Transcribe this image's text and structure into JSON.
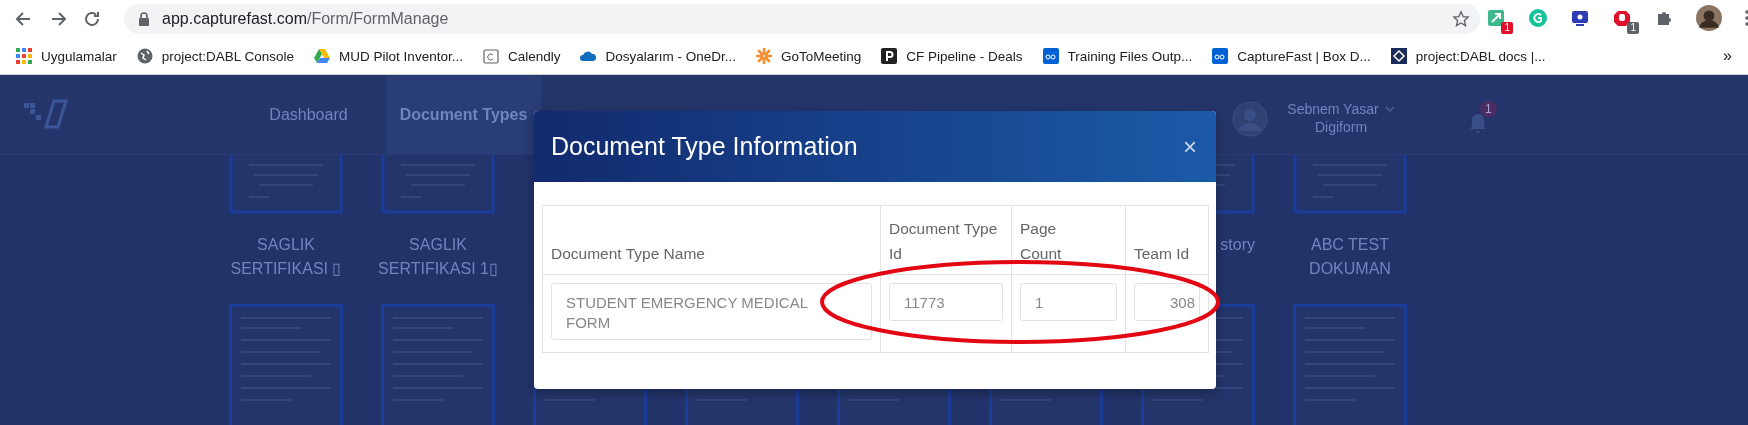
{
  "browser": {
    "url_host": "app.capturefast.com",
    "url_path": "/Form/FormManage",
    "extensions": [
      {
        "kind": "arrow",
        "badge": "1"
      },
      {
        "kind": "grammar"
      },
      {
        "kind": "screen"
      },
      {
        "kind": "hand",
        "badge": "1"
      },
      {
        "kind": "puzzle"
      },
      {
        "kind": "profile"
      }
    ],
    "bookmarks": [
      {
        "kind": "apps",
        "label": "Uygulamalar"
      },
      {
        "kind": "globe",
        "label": "project:DABL Console"
      },
      {
        "kind": "drive",
        "label": "MUD Pilot Inventor..."
      },
      {
        "kind": "calendar",
        "label": "Calendly"
      },
      {
        "kind": "cloud",
        "label": "Dosyalarım - OneDr..."
      },
      {
        "kind": "flower",
        "label": "GoToMeeting"
      },
      {
        "kind": "p",
        "label": "CF Pipeline - Deals"
      },
      {
        "kind": "box",
        "label": "Training Files Outp..."
      },
      {
        "kind": "box",
        "label": "CaptureFast | Box D..."
      },
      {
        "kind": "diamond",
        "label": "project:DABL docs |..."
      }
    ],
    "more": "»"
  },
  "nav": {
    "items": [
      {
        "label": "Dashboard",
        "selected": false
      },
      {
        "label": "Document Types",
        "selected": true
      }
    ],
    "user_name": "Sebnem Yasar",
    "company": "Digiform",
    "notifications": "1"
  },
  "documents": [
    {
      "kind": "full",
      "label": "SAGLIK SERTIFIKASI ▯"
    },
    {
      "kind": "full",
      "label": "SAGLIK SERTIFIKASI 1▯"
    },
    {
      "kind": "hidden"
    },
    {
      "kind": "hidden"
    },
    {
      "kind": "hidden"
    },
    {
      "kind": "hidden"
    },
    {
      "kind": "partial",
      "label": "story"
    },
    {
      "kind": "full",
      "label": "ABC TEST DOKUMAN"
    }
  ],
  "modal": {
    "title": "Document Type Information",
    "close": "×",
    "table": {
      "columns": [
        "Document Type Name",
        "Document Type Id",
        "Page Count",
        "Team Id"
      ],
      "rows": [
        [
          "STUDENT EMERGENCY MEDICAL FORM",
          "11773",
          "1",
          "308"
        ]
      ]
    }
  },
  "annotation": {
    "kind": "ellipse"
  }
}
